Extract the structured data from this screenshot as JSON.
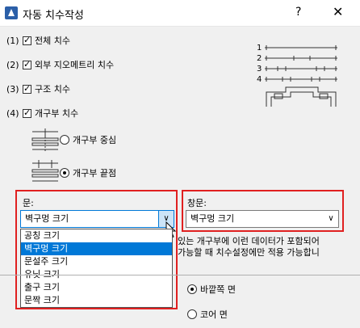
{
  "window": {
    "title": "자동 치수작성",
    "help_label": "?",
    "close_label": "✕"
  },
  "options": [
    {
      "num": "(1)",
      "label": "전체 치수",
      "checked": true
    },
    {
      "num": "(2)",
      "label": "외부 지오메트리 치수",
      "checked": true
    },
    {
      "num": "(3)",
      "label": "구조 치수",
      "checked": true
    },
    {
      "num": "(4)",
      "label": "개구부 치수",
      "checked": true
    }
  ],
  "opening_radios": [
    {
      "label": "개구부 중심",
      "selected": false
    },
    {
      "label": "개구부 끝점",
      "selected": true
    }
  ],
  "diagram_labels": [
    "1",
    "2",
    "3",
    "4"
  ],
  "door": {
    "label": "문:",
    "selected": "벽구멍 크기",
    "options": [
      "공칭 크기",
      "벽구멍 크기",
      "문설주 크기",
      "유닛 크기",
      "출구 크기",
      "문짝 크기"
    ],
    "highlighted_index": 1
  },
  "window_field": {
    "label": "창문:",
    "selected": "벽구멍 크기"
  },
  "note": {
    "line1": "있는 개구부에 이런 데이터가 포함되어",
    "line2": "가능할 때 치수설정에만 적용 가능합니"
  },
  "face_radios": [
    {
      "label": "바깥쪽 면",
      "selected": true
    },
    {
      "label": "코어 면",
      "selected": false
    }
  ]
}
